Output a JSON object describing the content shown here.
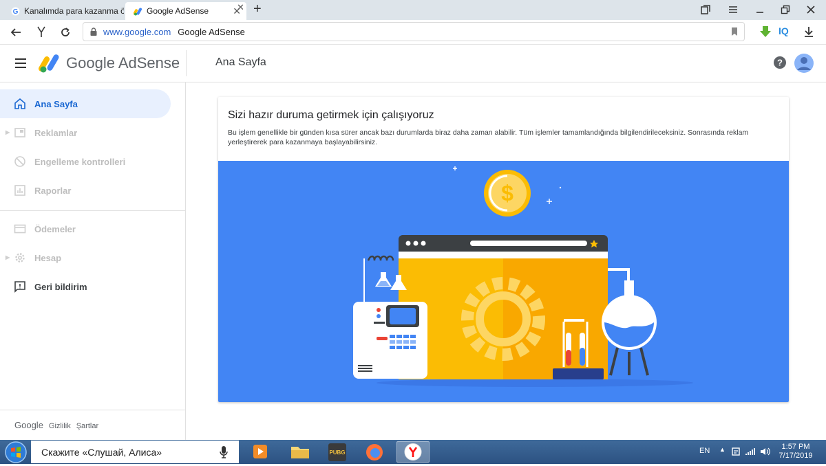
{
  "browser": {
    "tabs": [
      {
        "label": "Kanalımda para kazanma öz"
      },
      {
        "label": "Google AdSense"
      }
    ],
    "new_tab_symbol": "+",
    "address": {
      "domain": "www.google.com",
      "page_title": "Google AdSense"
    },
    "extension_label": "IQ"
  },
  "header": {
    "brand": "Google AdSense",
    "page_title": "Ana Sayfa"
  },
  "sidebar": {
    "items": [
      {
        "label": "Ana Sayfa",
        "icon": "home-icon"
      },
      {
        "label": "Reklamlar",
        "icon": "ads-icon"
      },
      {
        "label": "Engelleme kontrolleri",
        "icon": "block-icon"
      },
      {
        "label": "Raporlar",
        "icon": "reports-icon"
      },
      {
        "label": "Ödemeler",
        "icon": "payments-icon"
      },
      {
        "label": "Hesap",
        "icon": "gear-icon"
      },
      {
        "label": "Geri bildirim",
        "icon": "feedback-icon"
      }
    ],
    "footer": {
      "google": "Google",
      "privacy": "Gizlilik",
      "terms": "Şartlar"
    }
  },
  "card": {
    "title": "Sizi hazır duruma getirmek için çalışıyoruz",
    "body": "Bu işlem genellikle bir günden kısa sürer ancak bazı durumlarda biraz daha zaman alabilir. Tüm işlemler tamamlandığında bilgilendirileceksiniz. Sonrasında reklam yerleştirerek para kazanmaya başlayabilirsiniz."
  },
  "taskbar": {
    "search_text": "Скажите «Слушай, Алиса»",
    "language": "EN",
    "time": "1:57 PM",
    "date": "7/17/2019"
  },
  "colors": {
    "accent_blue": "#4285f4",
    "active_nav_bg": "#e8f0fe",
    "active_nav_text": "#1967d2",
    "illustration_orange": "#fbbc04"
  }
}
